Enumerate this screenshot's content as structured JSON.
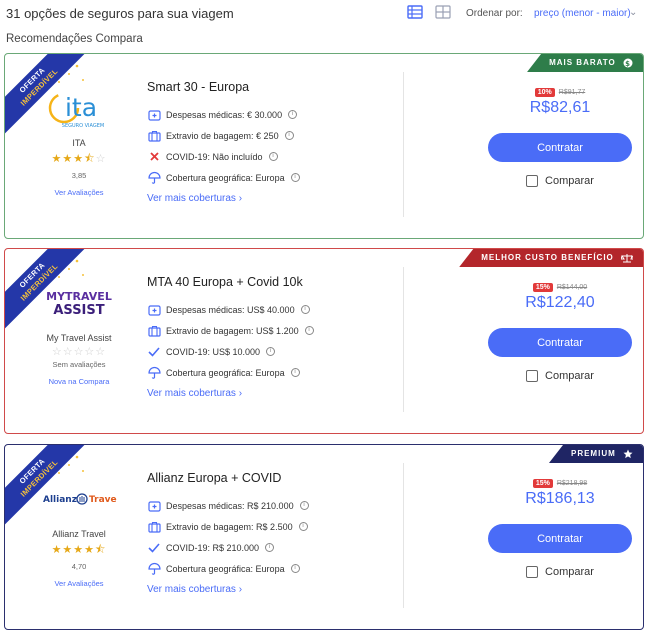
{
  "header": {
    "count_text": "31 opções de seguros para sua viagem",
    "sort_label": "Ordenar por:",
    "sort_value": "preço (menor - maior)",
    "subtitle": "Recomendações Compara"
  },
  "icons": {
    "list_view": "list-view-icon",
    "grid_view": "grid-view-icon",
    "sort_chevron": "chevron-down-icon"
  },
  "colors": {
    "accent": "#4a6cf7",
    "green": "#2e7d4a",
    "red": "#b3262b",
    "navy": "#1f2564",
    "discount": "#e23a3a",
    "star": "#e6a817"
  },
  "cards": [
    {
      "ribbon_line1": "OFERTA",
      "ribbon_line2": "IMPERDÍVEL",
      "badge": "MAIS BARATO",
      "badge_icon": "dollar-icon",
      "insurer": "ITA",
      "logo_text": "ita",
      "logo_subtext": "SEGURO VIAGEM",
      "stars": 3.85,
      "rating": "3,85",
      "reviews_link": "Ver Avaliações",
      "plan_name": "Smart 30 - Europa",
      "features": [
        {
          "icon": "medical-icon",
          "text": "Despesas médicas: € 30.000"
        },
        {
          "icon": "baggage-icon",
          "text": "Extravio de bagagem: € 250"
        },
        {
          "icon": "cross-icon",
          "text": "COVID-19: Não incluído"
        },
        {
          "icon": "umbrella-icon",
          "text": "Cobertura geográfica: Europa"
        }
      ],
      "more_link": "Ver mais coberturas ›",
      "discount": "10%",
      "old_price": "R$91,77",
      "price": "R$82,61",
      "button": "Contratar",
      "compare": "Comparar"
    },
    {
      "ribbon_line1": "OFERTA",
      "ribbon_line2": "IMPERDÍVEL",
      "badge": "MELHOR CUSTO BENEFÍCIO",
      "badge_icon": "scale-icon",
      "insurer": "My Travel Assist",
      "logo_text": "MYTRAVEL ASSIST",
      "logo_subtext": "",
      "stars": 0,
      "rating": "Sem avaliações",
      "reviews_link": "Nova na Compara",
      "plan_name": "MTA 40 Europa + Covid 10k",
      "features": [
        {
          "icon": "medical-icon",
          "text": "Despesas médicas: US$ 40.000"
        },
        {
          "icon": "baggage-icon",
          "text": "Extravio de bagagem: US$ 1.200"
        },
        {
          "icon": "check-icon",
          "text": "COVID-19: US$ 10.000"
        },
        {
          "icon": "umbrella-icon",
          "text": "Cobertura geográfica: Europa"
        }
      ],
      "more_link": "Ver mais coberturas ›",
      "discount": "15%",
      "old_price": "R$144,00",
      "price": "R$122,40",
      "button": "Contratar",
      "compare": "Comparar"
    },
    {
      "ribbon_line1": "OFERTA",
      "ribbon_line2": "IMPERDÍVEL",
      "badge": "PREMIUM",
      "badge_icon": "star-icon",
      "insurer": "Allianz Travel",
      "logo_text": "Allianz",
      "logo_subtext": "Travel",
      "stars": 4.7,
      "rating": "4,70",
      "reviews_link": "Ver Avaliações",
      "plan_name": "Allianz Europa + COVID",
      "features": [
        {
          "icon": "medical-icon",
          "text": "Despesas médicas: R$ 210.000"
        },
        {
          "icon": "baggage-icon",
          "text": "Extravio de bagagem: R$ 2.500"
        },
        {
          "icon": "check-icon",
          "text": "COVID-19: R$ 210.000"
        },
        {
          "icon": "umbrella-icon",
          "text": "Cobertura geográfica: Europa"
        }
      ],
      "more_link": "Ver mais coberturas ›",
      "discount": "15%",
      "old_price": "R$218,98",
      "price": "R$186,13",
      "button": "Contratar",
      "compare": "Comparar"
    }
  ]
}
